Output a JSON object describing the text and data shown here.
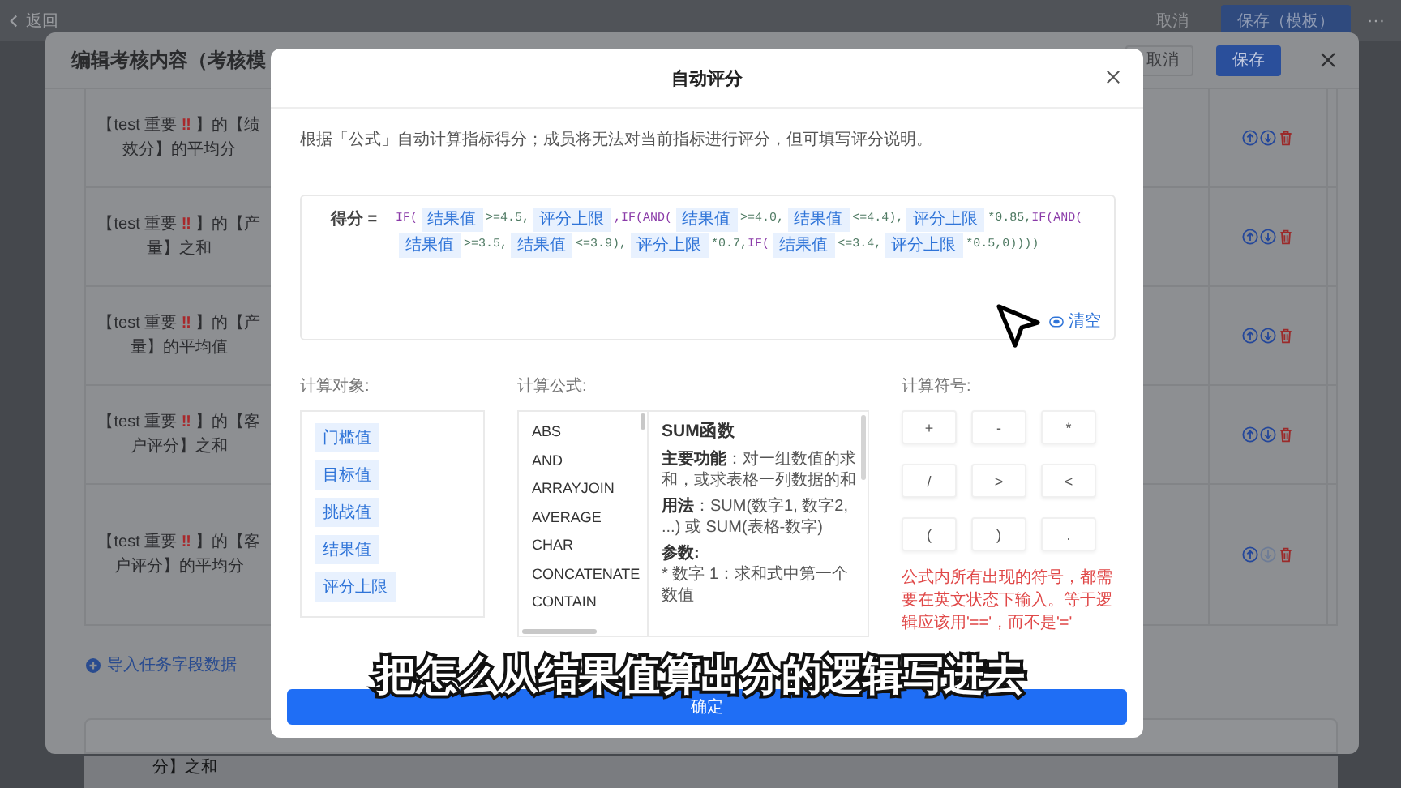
{
  "page": {
    "back_link": "返回",
    "cancel": "取消",
    "save_template": "保存（模板）",
    "more": "···",
    "behind_text": "分】之和"
  },
  "editor": {
    "title": "编辑考核内容（考核模",
    "cancel": "取消",
    "save": "保存",
    "rows": [
      {
        "before": "【test 重要 ",
        "flag": "‼",
        "after": " 】的【绩效分】的平均分",
        "down_disabled": false
      },
      {
        "before": "【test 重要 ",
        "flag": "‼",
        "after": " 】的【产量】之和",
        "down_disabled": false
      },
      {
        "before": "【test 重要 ",
        "flag": "‼",
        "after": " 】的【产量】的平均值",
        "down_disabled": false
      },
      {
        "before": "【test 重要 ",
        "flag": "‼",
        "after": " 】的【客户评分】之和",
        "down_disabled": false
      },
      {
        "before": "【test 重要 ",
        "flag": "‼",
        "after": " 】的【客户评分】的平均分",
        "down_disabled": true
      }
    ],
    "import_link": "导入任务字段数据"
  },
  "dialog": {
    "title": "自动评分",
    "description": "根据「公式」自动计算指标得分；成员将无法对当前指标进行评分，但可填写评分说明。",
    "formula": {
      "label": "得分 =",
      "clear": "清空",
      "tokens": [
        {
          "kind": "fn",
          "text": "IF("
        },
        {
          "kind": "field",
          "text": "结果值"
        },
        {
          "kind": "code",
          "text": ">=4.5,"
        },
        {
          "kind": "field",
          "text": "评分上限"
        },
        {
          "kind": "fn",
          "text": ",IF(AND("
        },
        {
          "kind": "field",
          "text": "结果值"
        },
        {
          "kind": "code",
          "text": ">=4.0,"
        },
        {
          "kind": "field",
          "text": "结果值"
        },
        {
          "kind": "code",
          "text": "<=4.4),"
        },
        {
          "kind": "field",
          "text": "评分上限"
        },
        {
          "kind": "code",
          "text": "*0.85,"
        },
        {
          "kind": "fn",
          "text": "IF(AND("
        },
        {
          "kind": "field",
          "text": "结果值"
        },
        {
          "kind": "code",
          "text": ">=3.5,"
        },
        {
          "kind": "field",
          "text": "结果值"
        },
        {
          "kind": "code",
          "text": "<=3.9),"
        },
        {
          "kind": "field",
          "text": "评分上限"
        },
        {
          "kind": "code",
          "text": "*0.7,"
        },
        {
          "kind": "fn",
          "text": "IF("
        },
        {
          "kind": "field",
          "text": "结果值"
        },
        {
          "kind": "code",
          "text": "<=3.4,"
        },
        {
          "kind": "field",
          "text": "评分上限"
        },
        {
          "kind": "code",
          "text": "*0.5,0))))"
        }
      ]
    },
    "objects": {
      "label": "计算对象:",
      "items": [
        "门槛值",
        "目标值",
        "挑战值",
        "结果值",
        "评分上限"
      ]
    },
    "functions": {
      "label": "计算公式:",
      "items": [
        "ABS",
        "AND",
        "ARRAYJOIN",
        "AVERAGE",
        "CHAR",
        "CONCATENATE",
        "CONTAIN"
      ],
      "detail": {
        "title": "SUM函数",
        "paragraphs": [
          {
            "kind": "text",
            "text": "**主要功能**：对一组数值的求和，或求表格一列数据的和"
          },
          {
            "kind": "text",
            "text": "**用法**：SUM(数字1, 数字2, ...) 或 SUM(表格-数字)"
          },
          {
            "kind": "heading",
            "text": "参数:"
          },
          {
            "kind": "item",
            "text": "* 数字 1：求和式中第一个数值"
          }
        ]
      }
    },
    "symbols": {
      "label": "计算符号:",
      "keys": [
        "+",
        "-",
        "*",
        "/",
        ">",
        "<",
        "(",
        ")",
        "."
      ],
      "note": "公式内所有出现的符号，都需要在英文状态下输入。等于逻辑应该用'=='，而不是'='"
    },
    "confirm": "确定"
  },
  "subtitle": "把怎么从结果值算出分的逻辑写进去"
}
